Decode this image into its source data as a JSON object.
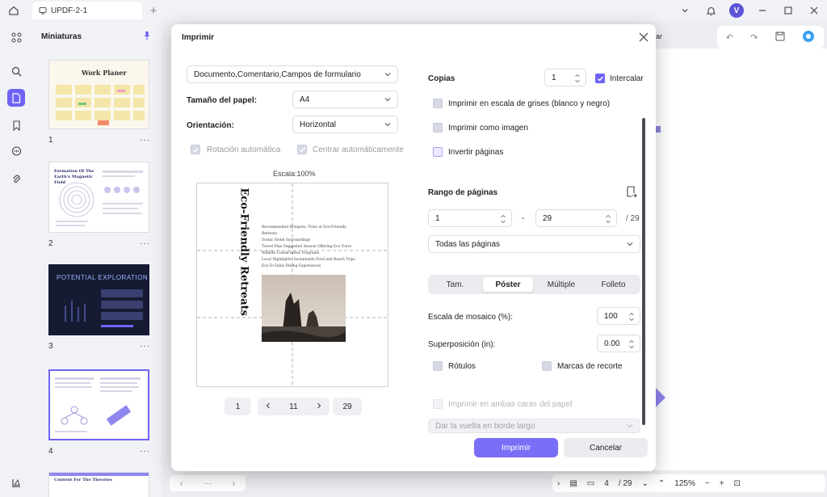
{
  "window": {
    "tab_title": "UPDF-2-1",
    "avatar_letter": "V"
  },
  "thumbnails": {
    "title": "Miniaturas",
    "pages": [
      {
        "number": "1",
        "heading": "Work Planer"
      },
      {
        "number": "2",
        "heading": "Formation Of The Earth's Magnetic Field"
      },
      {
        "number": "3",
        "heading": "POTENTIAL EXPLORATION"
      },
      {
        "number": "4",
        "heading": ""
      },
      {
        "number": "",
        "heading": "Content For The Theories"
      }
    ],
    "more": "···"
  },
  "document": {
    "cerrar_fragment": "rrar",
    "zoom": "125%",
    "page_current": "4",
    "page_total": "/ 29",
    "pager_more": "···"
  },
  "dialog": {
    "title": "Imprimir",
    "content_select": "Documento,Comentario,Campos de formulario",
    "paper_size_label": "Tamaño del papel:",
    "paper_size_value": "A4",
    "orientation_label": "Orientación:",
    "orientation_value": "Horizontal",
    "auto_rotate": "Rotación automática",
    "auto_center": "Centrar automáticamente",
    "scale_label": "Escala:100%",
    "preview": {
      "title": "Eco-Friendly Retreats",
      "lines": [
        "Recommended Hotspots: Trine at Eco-Friendly Retreats",
        "Scenic Hotel Surroundings",
        "Travel Plan Suggested Season Offering Eco Tours",
        "Wildlife Conservation Programs",
        "Local Highlights: Sustainable Food and Beach Trips",
        "Eco-To-Table Dining Experiences"
      ]
    },
    "nav": {
      "first": "1",
      "current": "11",
      "last": "29"
    },
    "copies_label": "Copias",
    "copies_value": "1",
    "collate_label": "Intercalar",
    "grayscale_label": "Imprimir en escala de grises (blanco y negro)",
    "as_image_label": "Imprimir como imagen",
    "invert_label": "Invertir páginas",
    "range_label": "Rango de páginas",
    "range_from": "1",
    "range_to": "29",
    "range_total": "/ 29",
    "range_dash": "-",
    "range_select": "Todas las páginas",
    "tabs": [
      "Tam.",
      "Póster",
      "Múltiple",
      "Folleto"
    ],
    "tile_scale_label": "Escala de mosaico (%):",
    "tile_scale_value": "100",
    "overlap_label": "Superposición (in):",
    "overlap_value": "0.00",
    "labels_label": "Rótulos",
    "cut_marks_label": "Marcas de recorte",
    "duplex_label": "Imprimir en ambas caras del papel",
    "flip_select": "Dar la vuelta en borde largo",
    "print_button": "Imprimir",
    "cancel_button": "Cancelar"
  },
  "colors": {
    "accent": "#6e63f5",
    "primary_button": "#7b6ef6"
  }
}
